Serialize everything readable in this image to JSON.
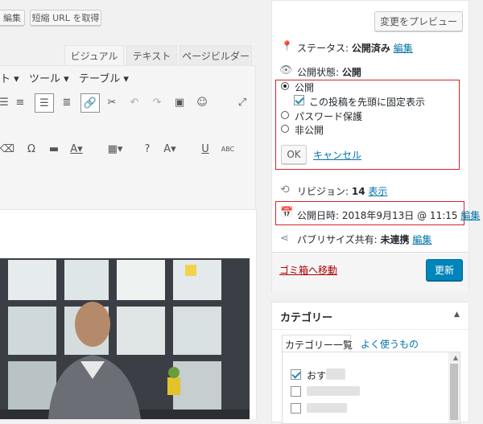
{
  "top": {
    "edit_btn": "編集",
    "short_url_btn": "短縮 URL を取得"
  },
  "editor": {
    "tabs": [
      "ビジュアル",
      "テキスト",
      "ページビルダー"
    ],
    "menus": [
      "ト ▾",
      "ツール ▾",
      "テーブル ▾"
    ]
  },
  "publish": {
    "preview_btn": "変更をプレビュー",
    "status_label": "ステータス:",
    "status_value": "公開済み",
    "status_edit": "編集",
    "visibility_label": "公開状態:",
    "visibility_value": "公開",
    "options": {
      "public": "公開",
      "sticky": "この投稿を先頭に固定表示",
      "password": "パスワード保護",
      "private": "非公開"
    },
    "ok_btn": "OK",
    "cancel_link": "キャンセル",
    "revisions_label": "リビジョン:",
    "revisions_count": "14",
    "revisions_link": "表示",
    "published_on": "公開日時: 2018年9月13日 @ 11:15",
    "published_edit": "編集",
    "publicize_label": "パブリサイズ共有:",
    "publicize_value": "未連携",
    "publicize_edit": "編集",
    "trash_link": "ゴミ箱へ移動",
    "update_btn": "更新"
  },
  "category": {
    "title": "カテゴリー",
    "tab_all": "カテゴリー一覧",
    "tab_popular": "よく使うもの",
    "first_item": "おすすめ"
  },
  "colors": {
    "accent": "#0085ba",
    "link": "#0073aa",
    "highlight": "#d3242a"
  }
}
